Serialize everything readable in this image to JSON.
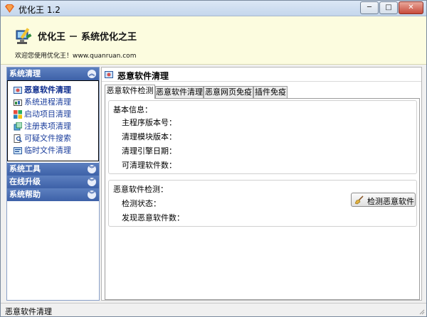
{
  "window": {
    "title": "优化王 1.2",
    "min_label": "─",
    "max_label": "□",
    "close_label": "✕"
  },
  "banner": {
    "title": "优化王 － 系统优化之王",
    "welcome": "欢迎您使用优化王！www.quanruan.com"
  },
  "sidebar": {
    "sections": [
      {
        "label": "系统清理",
        "expanded": true
      },
      {
        "label": "系统工具",
        "expanded": false
      },
      {
        "label": "在线升级",
        "expanded": false
      },
      {
        "label": "系统帮助",
        "expanded": false
      }
    ],
    "items": [
      {
        "label": "恶意软件清理",
        "icon": "malware-cleanup-icon",
        "active": true
      },
      {
        "label": "系统进程清理",
        "icon": "process-cleanup-icon",
        "active": false
      },
      {
        "label": "启动项目清理",
        "icon": "startup-cleanup-icon",
        "active": false
      },
      {
        "label": "注册表项清理",
        "icon": "registry-cleanup-icon",
        "active": false
      },
      {
        "label": "可疑文件搜索",
        "icon": "file-search-icon",
        "active": false
      },
      {
        "label": "临时文件清理",
        "icon": "temp-file-cleanup-icon",
        "active": false
      }
    ],
    "collapse_glyph": "︽",
    "expand_glyph": "︾"
  },
  "main": {
    "title": "恶意软件清理",
    "tabs": [
      {
        "label": "恶意软件检测",
        "active": true
      },
      {
        "label": "恶意软件清理",
        "active": false
      },
      {
        "label": "恶意网页免疫",
        "active": false
      },
      {
        "label": "插件免疫",
        "active": false
      }
    ],
    "basic_info": {
      "title": "基本信息：",
      "fields": [
        "主程序版本号：",
        "清理模块版本：",
        "清理引擎日期：",
        "可清理软件数："
      ]
    },
    "detection": {
      "title": "恶意软件检测：",
      "status_label": "检测状态：",
      "found_label": "发现恶意软件数：",
      "button_label": "检测恶意软件"
    }
  },
  "statusbar": {
    "text": "恶意软件清理"
  },
  "colors": {
    "banner_bg": "#fcfcdf",
    "section_header": "#4a6db3",
    "nav_text": "#1a3d9c"
  }
}
